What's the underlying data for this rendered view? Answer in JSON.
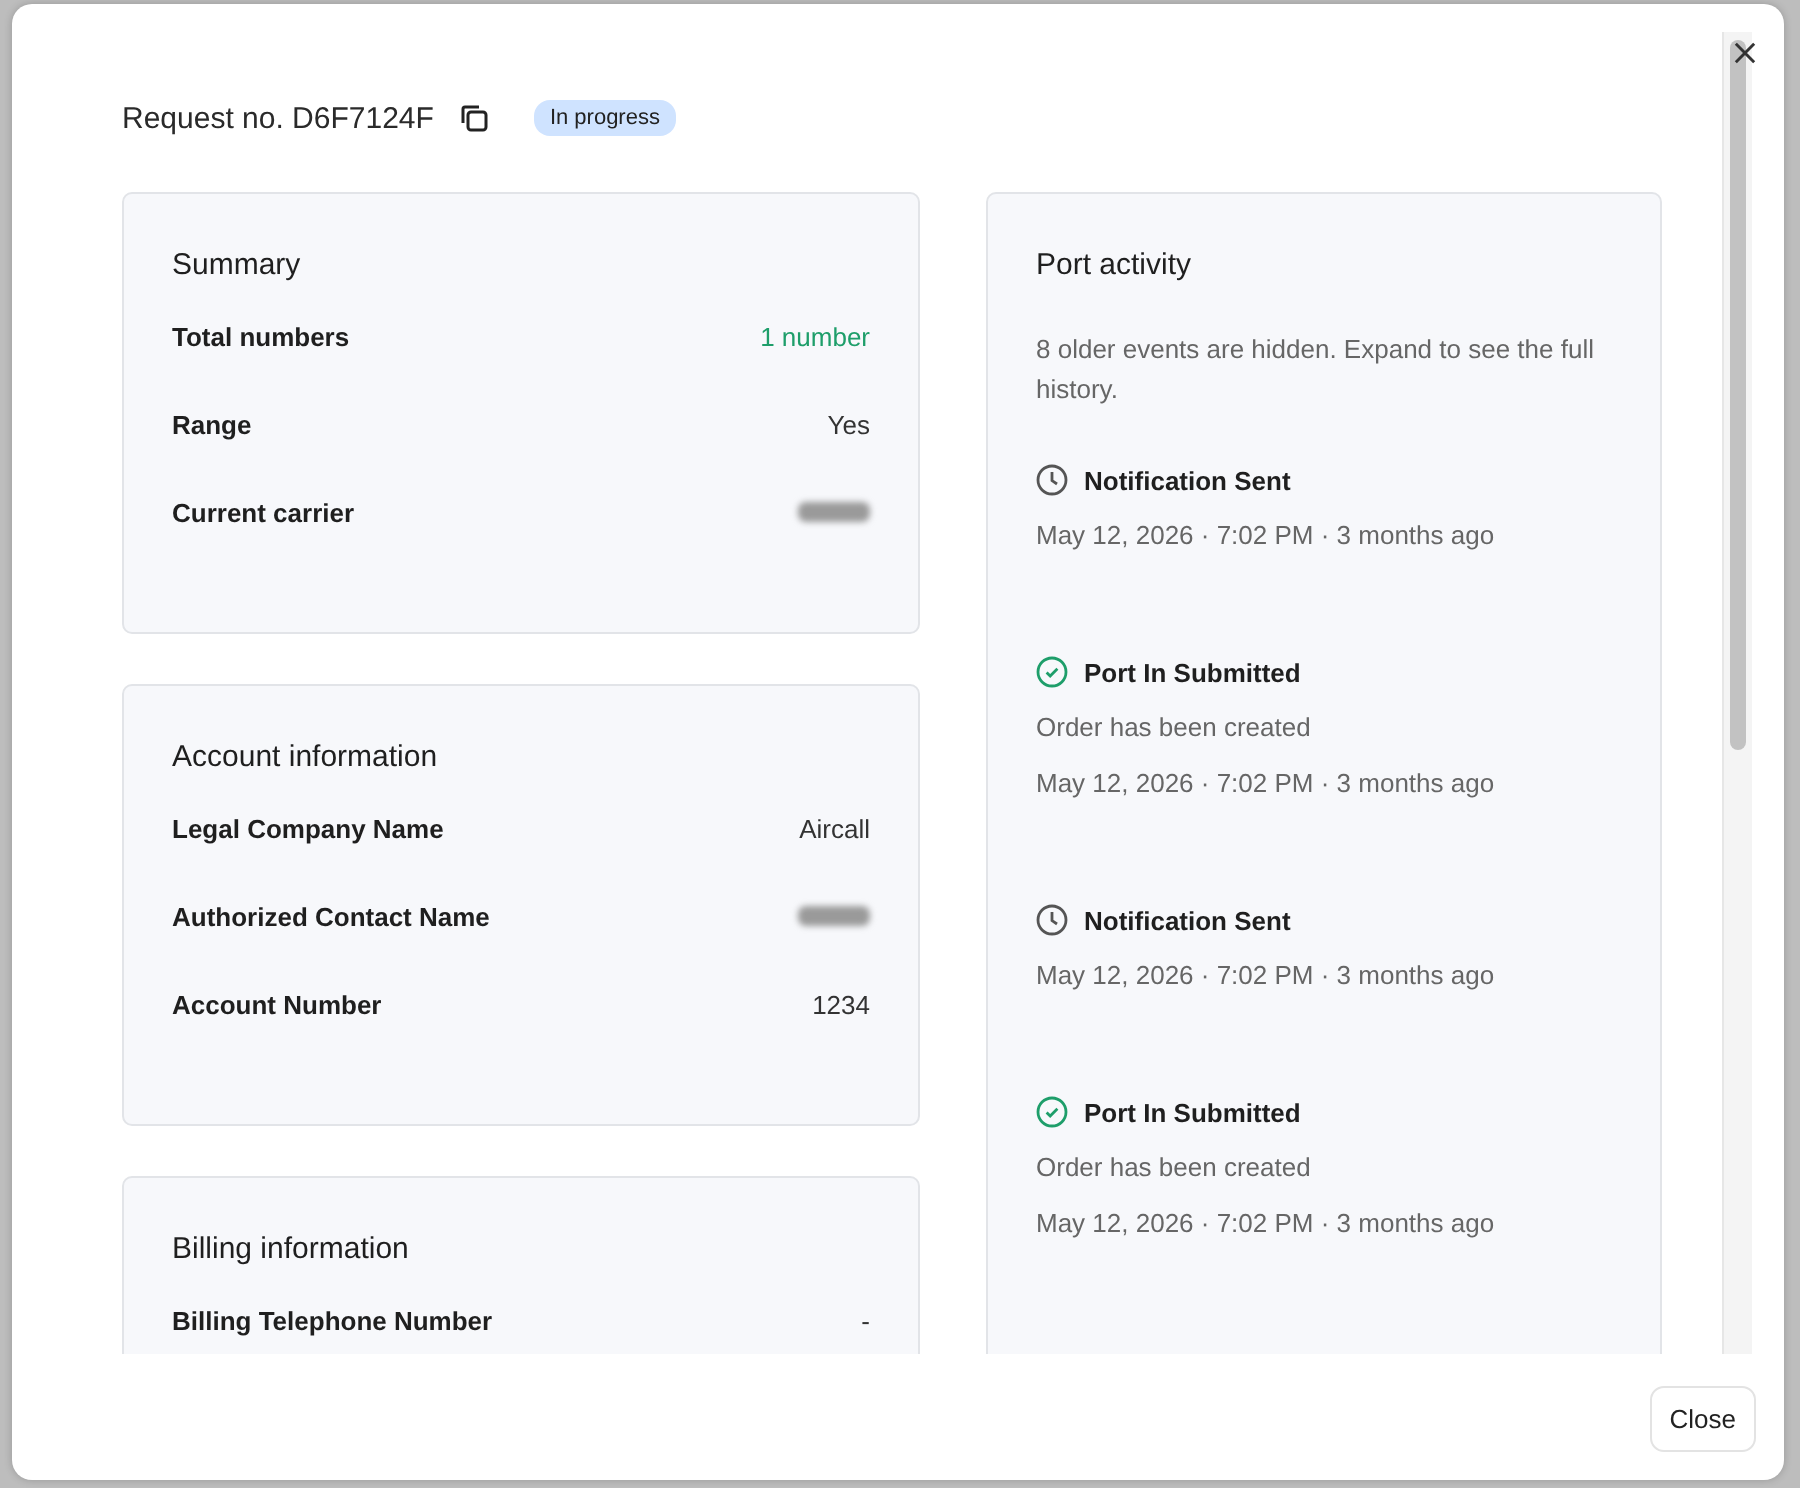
{
  "header": {
    "title": "Request no. D6F7124F",
    "status": "In progress"
  },
  "sections": [
    {
      "title": "Summary",
      "rows": [
        {
          "label": "Total numbers",
          "value": "1 number",
          "kind": "highlight"
        },
        {
          "label": "Range",
          "value": "Yes",
          "kind": "plain"
        },
        {
          "label": "Current carrier",
          "kind": "redacted"
        }
      ]
    },
    {
      "title": "Account information",
      "rows": [
        {
          "label": "Legal Company Name",
          "value": "Aircall",
          "kind": "plain"
        },
        {
          "label": "Authorized Contact Name",
          "kind": "redacted"
        },
        {
          "label": "Account Number",
          "value": "1234",
          "kind": "plain"
        }
      ]
    },
    {
      "title": "Billing information",
      "rows": [
        {
          "label": "Billing Telephone Number",
          "value": "-",
          "kind": "plain"
        }
      ]
    }
  ],
  "activity": {
    "title": "Port activity",
    "note": "8 older events are hidden. Expand to see the full history.",
    "events": [
      {
        "kind": "clock",
        "title": "Notification Sent",
        "time": "May 12, 2026 · 7:02 PM · 3 months ago"
      },
      {
        "kind": "check",
        "title": "Port In Submitted",
        "description": "Order has been created",
        "time": "May 12, 2026 · 7:02 PM · 3 months ago"
      },
      {
        "kind": "clock",
        "title": "Notification Sent",
        "time": "May 12, 2026 · 7:02 PM · 3 months ago"
      },
      {
        "kind": "check",
        "title": "Port In Submitted",
        "description": "Order has been created",
        "time": "May 12, 2026 · 7:02 PM · 3 months ago"
      }
    ]
  },
  "footer": {
    "button": "Close"
  }
}
